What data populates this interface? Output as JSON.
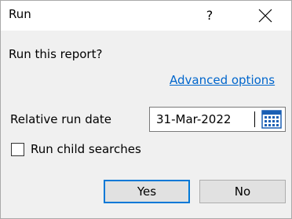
{
  "window": {
    "title": "Run",
    "help_label": "?",
    "close_icon": "close-icon"
  },
  "prompt": {
    "question": "Run this report?",
    "advanced_link": "Advanced options"
  },
  "date_field": {
    "label": "Relative run date",
    "value": "31-Mar-2022",
    "icon": "calendar-icon"
  },
  "options": {
    "run_child_searches_label": "Run child searches",
    "run_child_searches_checked": false
  },
  "buttons": {
    "yes_label": "Yes",
    "no_label": "No"
  },
  "colors": {
    "link": "#0066cc",
    "focus_border": "#0078d7",
    "calendar_blue": "#1a5fb4"
  }
}
